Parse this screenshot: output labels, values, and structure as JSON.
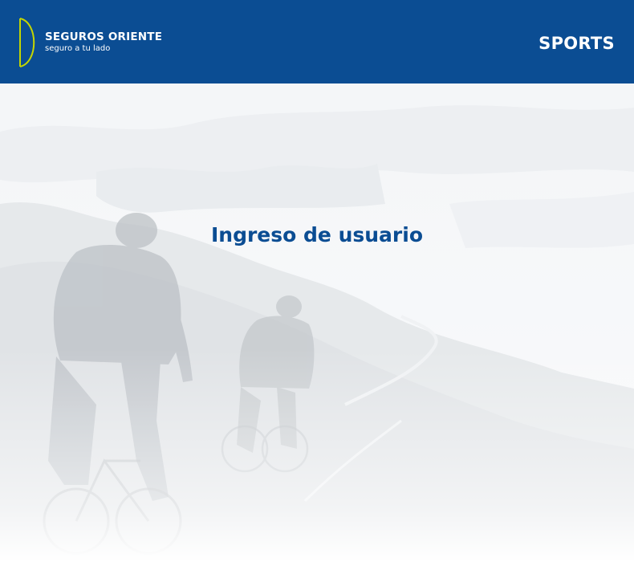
{
  "header": {
    "brand_name": "SEGUROS ORIENTE",
    "brand_tagline": "seguro a tu lado",
    "section": "SPORTS"
  },
  "main": {
    "heading": "Ingreso de usuario"
  },
  "colors": {
    "brand_blue": "#0b4d93",
    "accent_green": "#c4d600",
    "heading_blue": "#0b4d93"
  },
  "icons": {
    "logo_mark": "crescent-d-logo-icon"
  }
}
